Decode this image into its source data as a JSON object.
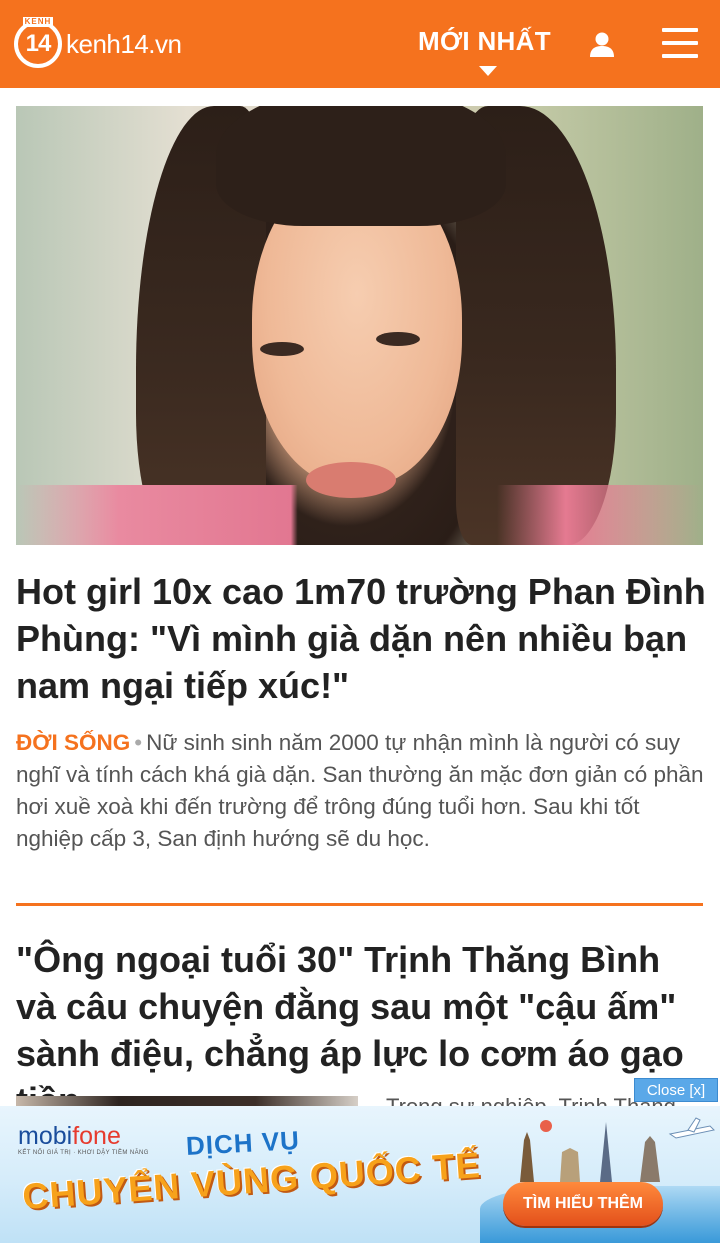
{
  "header": {
    "logo_badge": "14",
    "logo_strip": "KENH",
    "logo_text": "kenh14.vn",
    "nav_latest": "MỚI NHẤT"
  },
  "article1": {
    "title": "Hot girl 10x cao 1m70 trường Phan Đình Phùng: \"Vì mình già dặn nên nhiều bạn nam ngại tiếp xúc!\"",
    "category": "ĐỜI SỐNG",
    "separator": "•",
    "summary": "Nữ sinh sinh năm 2000 tự nhận mình là người có suy nghĩ và tính cách khá già dặn. San thường ăn mặc đơn giản có phần hơi xuề xoà khi đến trường để trông đúng tuổi hơn. Sau khi tốt nghiệp cấp 3, San định hướng sẽ du học."
  },
  "article2": {
    "title": "\"Ông ngoại tuổi 30\" Trịnh Thăng Bình và câu chuyện đằng sau một \"cậu ấm\" sành điệu, chẳng áp lực lo cơm áo gạo tiền",
    "summary": "Trong sự nghiệp, Trịnh Thăng"
  },
  "ad": {
    "close_label": "Close [x]",
    "brand_mobi": "mobi",
    "brand_fone": "fone",
    "brand_slogan": "KẾT NỐI GIÁ TRỊ · KHƠI DẬY TIỀM NĂNG",
    "headline_small": "DỊCH VỤ",
    "headline_main": "CHUYỂN VÙNG QUỐC TẾ",
    "cta": "TÌM HIỂU THÊM"
  },
  "colors": {
    "brand_orange": "#f5721e",
    "ad_blue": "#1d73c8"
  },
  "icons": [
    "user-icon",
    "hamburger-menu-icon",
    "caret-down-icon"
  ]
}
